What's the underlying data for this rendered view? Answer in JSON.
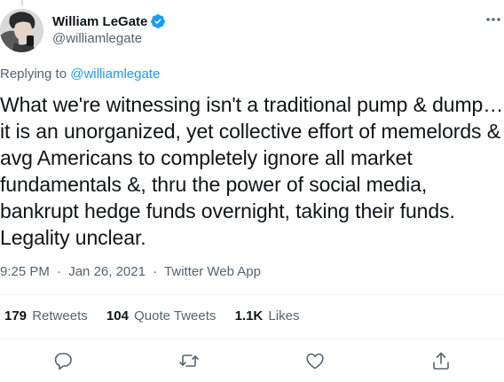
{
  "author": {
    "display_name": "William LeGate",
    "handle": "@williamlegate",
    "verified": true
  },
  "replying": {
    "prefix": "Replying to",
    "mention": "@williamlegate"
  },
  "tweet": {
    "text": "What we're witnessing isn't a traditional pump & dump… it is an unorganized, yet collective effort of memelords & avg Americans to completely ignore all market fundamentals &, thru the power of social media, bankrupt hedge funds overnight, taking their funds. Legality unclear.",
    "time": "9:25 PM",
    "date": "Jan 26, 2021",
    "separator": "·",
    "source": "Twitter Web App"
  },
  "stats": {
    "retweets_count": "179",
    "retweets_label": "Retweets",
    "quotes_count": "104",
    "quotes_label": "Quote Tweets",
    "likes_count": "1.1K",
    "likes_label": "Likes"
  },
  "icons": {
    "verified": "verified-badge-icon",
    "more": "more-options-icon",
    "reply": "reply-icon",
    "retweet": "retweet-icon",
    "like": "heart-icon",
    "share": "share-icon"
  },
  "colors": {
    "accent": "#1d9bf0",
    "secondary_text": "#536471",
    "primary_text": "#0f1419",
    "divider": "#eff3f4"
  }
}
